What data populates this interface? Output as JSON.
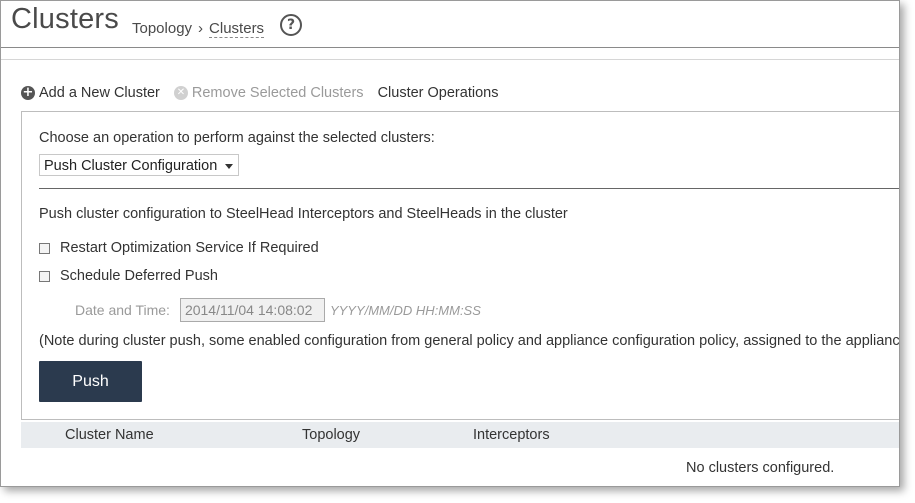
{
  "page": {
    "title": "Clusters",
    "breadcrumb": {
      "parent": "Topology",
      "separator": "›",
      "current": "Clusters"
    },
    "help_icon_glyph": "?"
  },
  "toolbar": {
    "add_label": "Add a New Cluster",
    "remove_label": "Remove Selected Clusters",
    "operations_label": "Cluster Operations",
    "add_icon": "plus-circle-icon",
    "remove_icon": "x-circle-icon"
  },
  "operations": {
    "choose_label": "Choose an operation to perform against the selected clusters:",
    "selected_operation": "Push Cluster Configuration",
    "description": "Push cluster configuration to SteelHead Interceptors and SteelHeads in the cluster",
    "restart_label": "Restart Optimization Service If Required",
    "restart_checked": false,
    "deferred_label": "Schedule Deferred Push",
    "deferred_checked": false,
    "datetime_label": "Date and Time:",
    "datetime_value": "2014/11/04 14:08:02",
    "datetime_hint": "YYYY/MM/DD HH:MM:SS",
    "note": "(Note during cluster push, some enabled configuration from general policy and appliance configuration policy, assigned to the appliance",
    "push_label": "Push"
  },
  "table": {
    "columns": [
      "Cluster Name",
      "Topology",
      "Interceptors"
    ],
    "empty_message": "No clusters configured."
  },
  "colors": {
    "push_button": "#2b3a4e",
    "table_header_bg": "#e9ecef",
    "disabled_text": "#9a9a9a"
  }
}
